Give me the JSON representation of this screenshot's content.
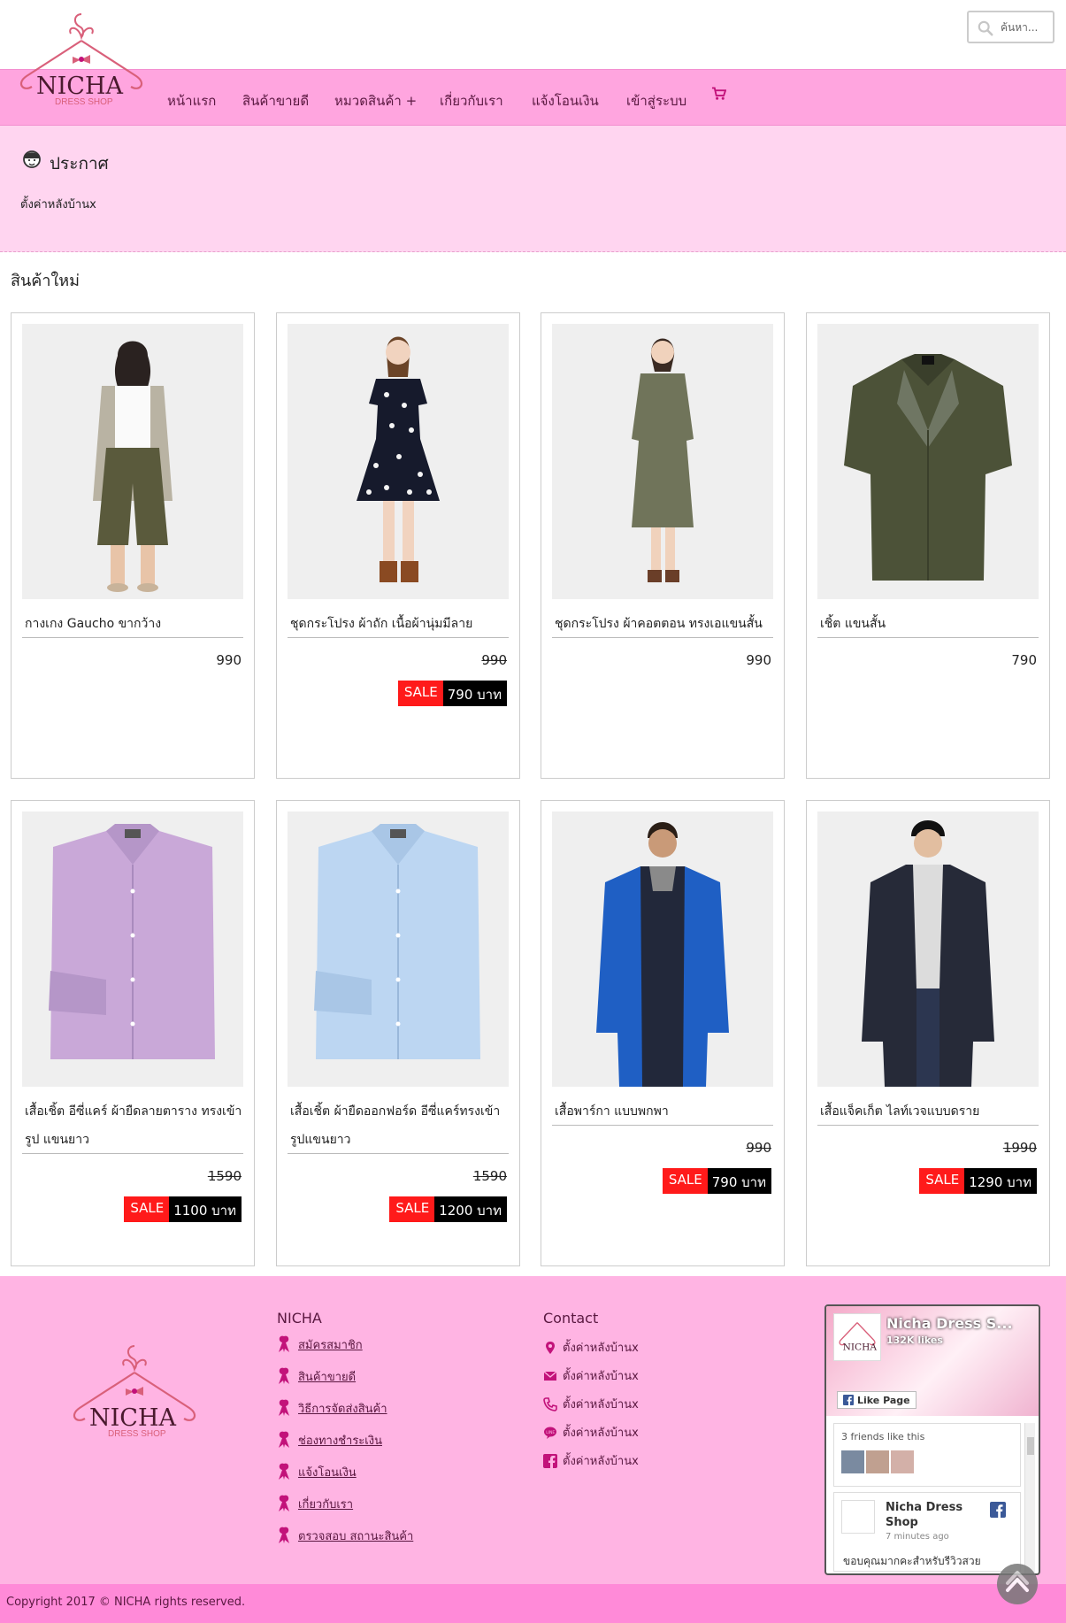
{
  "brand": {
    "name": "NICHA",
    "tagline": "DRESS SHOP",
    "colors": {
      "nav": "#ffa5df",
      "announce": "#ffd5f0",
      "footer": "#ffb4e3",
      "copyright": "#ff8ad8",
      "sale_tag": "#ff1a1a",
      "accent": "#e5007d"
    }
  },
  "search": {
    "placeholder": "ค้นหา..."
  },
  "nav": {
    "items": [
      "หน้าแรก",
      "สินค้าขายดี",
      "หมวดสินค้า +",
      "เกี่ยวกับเรา",
      "แจ้งโอนเงิน",
      "เข้าสู่ระบบ"
    ],
    "cart_icon": "cart-icon"
  },
  "announcement": {
    "title": "ประกาศ",
    "text": "ตั้งค่าหลังบ้านx"
  },
  "section_title": "สินค้าใหม่",
  "products": [
    {
      "name": "กางเกง Gaucho ขากว้าง",
      "price": "990",
      "sale_label": "",
      "sale_price": ""
    },
    {
      "name": "ชุดกระโปรง ผ้าถัก เนื้อผ้านุ่มมีลาย",
      "price": "990",
      "sale_label": "SALE",
      "sale_price": "790 บาท"
    },
    {
      "name": "ชุดกระโปรง ผ้าคอตตอน ทรงเอแขนสั้น",
      "price": "990",
      "sale_label": "",
      "sale_price": ""
    },
    {
      "name": "เชิ้ต แขนสั้น",
      "price": "790",
      "sale_label": "",
      "sale_price": ""
    },
    {
      "name": "เสื้อเชิ้ต อีซี่แคร์ ผ้ายืดลายตาราง ทรงเข้ารูป แขนยาว",
      "price": "1590",
      "sale_label": "SALE",
      "sale_price": "1100 บาท"
    },
    {
      "name": "เสื้อเชิ้ต ผ้ายืดออกฟอร์ด อีซี่แคร์ทรงเข้ารูปแขนยาว",
      "price": "1590",
      "sale_label": "SALE",
      "sale_price": "1200 บาท"
    },
    {
      "name": "เสื้อพาร์กา แบบพกพา",
      "price": "990",
      "sale_label": "SALE",
      "sale_price": "790 บาท"
    },
    {
      "name": "เสื้อแจ็คเก็ต ไลท์เวจแบบดราย",
      "price": "1990",
      "sale_label": "SALE",
      "sale_price": "1290 บาท"
    }
  ],
  "footer": {
    "col1_title": "NICHA",
    "links": [
      "สมัครสมาชิก",
      "สินค้าขายดี",
      "วิธีการจัดส่งสินค้า",
      "ช่องทางชำระเงิน",
      "แจ้งโอนเงิน",
      "เกี่ยวกับเรา",
      "ตรวจสอบ สถานะสินค้า"
    ],
    "col2_title": "Contact",
    "contacts": [
      {
        "icon": "map-pin-icon",
        "text": "ตั้งค่าหลังบ้านx"
      },
      {
        "icon": "envelope-icon",
        "text": "ตั้งค่าหลังบ้านx"
      },
      {
        "icon": "phone-icon",
        "text": "ตั้งค่าหลังบ้านx"
      },
      {
        "icon": "line-icon",
        "text": "ตั้งค่าหลังบ้านx"
      },
      {
        "icon": "facebook-icon",
        "text": "ตั้งค่าหลังบ้านx"
      }
    ]
  },
  "facebook_widget": {
    "page_name": "Nicha Dress S...",
    "likes": "132K likes",
    "like_button": "Like Page",
    "friends_text": "3 friends like this",
    "post_author": "Nicha Dress Shop",
    "post_time": "7 minutes ago",
    "post_text": "ขอบคุณมากคะสำหรับรีวิวสวย"
  },
  "copyright": "Copyright 2017 © NICHA rights reserved."
}
